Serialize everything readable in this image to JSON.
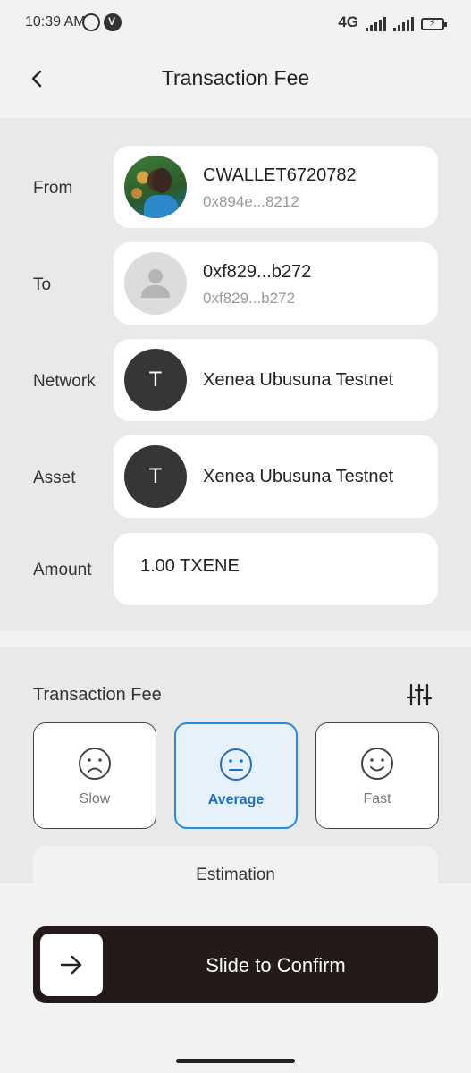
{
  "status_bar": {
    "time": "10:39 AM",
    "network": "4G",
    "icons": [
      "whatsapp-icon",
      "vpn-badge-icon",
      "signal-icon",
      "battery-charging-icon"
    ]
  },
  "header": {
    "title": "Transaction Fee",
    "back_icon": "chevron-left-icon"
  },
  "details": {
    "from": {
      "label": "From",
      "name": "CWALLET6720782",
      "address": "0x894e...8212",
      "avatar": "profile-photo"
    },
    "to": {
      "label": "To",
      "name": "0xf829...b272",
      "address": "0xf829...b272",
      "avatar": "person-placeholder-icon"
    },
    "network": {
      "label": "Network",
      "avatar_letter": "T",
      "value": "Xenea Ubusuna Testnet"
    },
    "asset": {
      "label": "Asset",
      "avatar_letter": "T",
      "value": "Xenea Ubusuna Testnet"
    },
    "amount": {
      "label": "Amount",
      "value": "1.00 TXENE"
    }
  },
  "fee": {
    "title": "Transaction Fee",
    "settings_icon": "sliders-icon",
    "options": [
      {
        "label": "Slow",
        "icon": "sad-face-icon",
        "selected": false
      },
      {
        "label": "Average",
        "icon": "neutral-face-icon",
        "selected": true
      },
      {
        "label": "Fast",
        "icon": "smile-face-icon",
        "selected": false
      }
    ],
    "estimation_label": "Estimation"
  },
  "confirm": {
    "label": "Slide to Confirm",
    "handle_icon": "arrow-right-icon"
  },
  "colors": {
    "accent": "#2d88d6",
    "slider_bg": "#251a1a",
    "avatar_dark": "#363636"
  }
}
